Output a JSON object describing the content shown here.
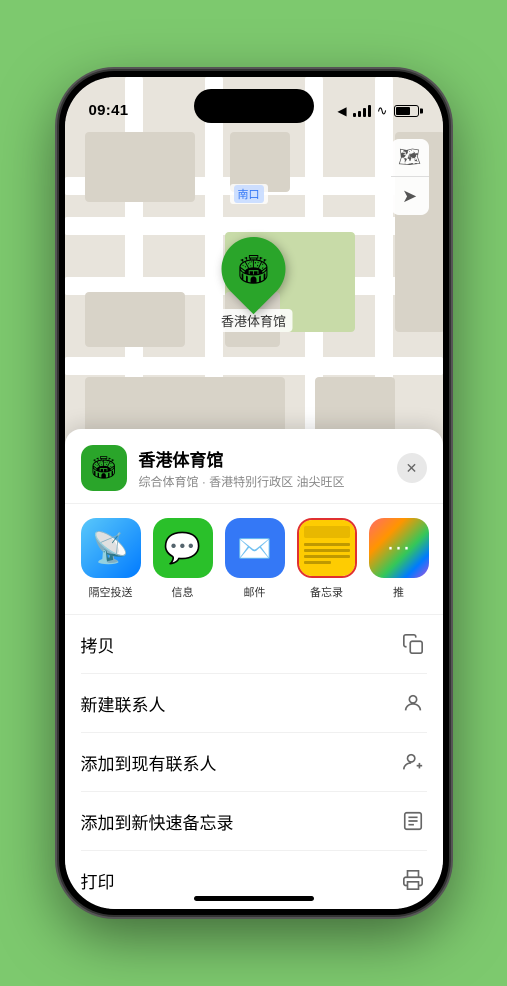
{
  "statusBar": {
    "time": "09:41",
    "locationArrow": "▶"
  },
  "map": {
    "locationLabel": "南口",
    "venueName": "香港体育馆",
    "pinEmoji": "🏟"
  },
  "mapControls": {
    "layerBtn": "🗺",
    "locationBtn": "➤"
  },
  "sheet": {
    "closeBtn": "✕",
    "venueEmoji": "🏟",
    "venueName": "香港体育馆",
    "venueSubtitle": "综合体育馆 · 香港特别行政区 油尖旺区"
  },
  "shareItems": [
    {
      "id": "airdrop",
      "label": "隔空投送",
      "type": "airdrop"
    },
    {
      "id": "messages",
      "label": "信息",
      "type": "messages"
    },
    {
      "id": "mail",
      "label": "邮件",
      "type": "mail"
    },
    {
      "id": "notes",
      "label": "备忘录",
      "type": "notes"
    },
    {
      "id": "more",
      "label": "推",
      "type": "more"
    }
  ],
  "actions": [
    {
      "id": "copy",
      "label": "拷贝",
      "iconType": "copy"
    },
    {
      "id": "new-contact",
      "label": "新建联系人",
      "iconType": "person-add"
    },
    {
      "id": "add-contact",
      "label": "添加到现有联系人",
      "iconType": "person-plus"
    },
    {
      "id": "quick-note",
      "label": "添加到新快速备忘录",
      "iconType": "note"
    },
    {
      "id": "print",
      "label": "打印",
      "iconType": "printer"
    }
  ]
}
